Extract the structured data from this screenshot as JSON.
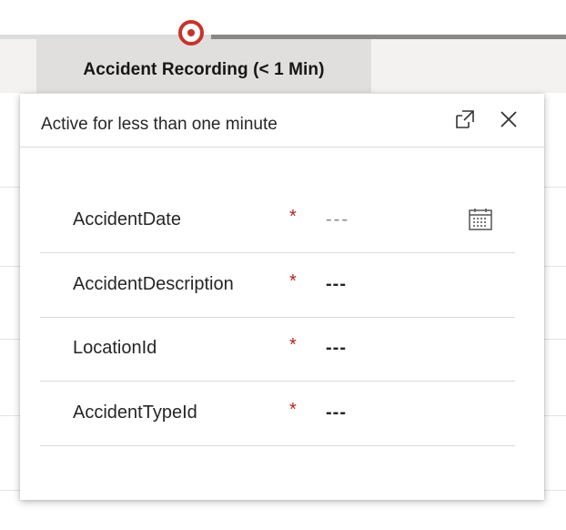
{
  "stage": {
    "label": "Accident Recording  (< 1 Min)",
    "marker_color": "#c7332b"
  },
  "flyout": {
    "title": "Active for less than one minute",
    "icons": [
      "popout-icon",
      "close-icon"
    ],
    "fields": [
      {
        "label": "AccidentDate",
        "required": "*",
        "value": "---",
        "placeholder": true,
        "icon": "calendar-icon"
      },
      {
        "label": "AccidentDescription",
        "required": "*",
        "value": "---",
        "placeholder": false
      },
      {
        "label": "LocationId",
        "required": "*",
        "value": "---",
        "placeholder": false
      },
      {
        "label": "AccidentTypeId",
        "required": "*",
        "value": "---",
        "placeholder": false
      }
    ]
  },
  "colors": {
    "required": "#b3221c",
    "active_stage_bg": "#e1dfdd"
  }
}
